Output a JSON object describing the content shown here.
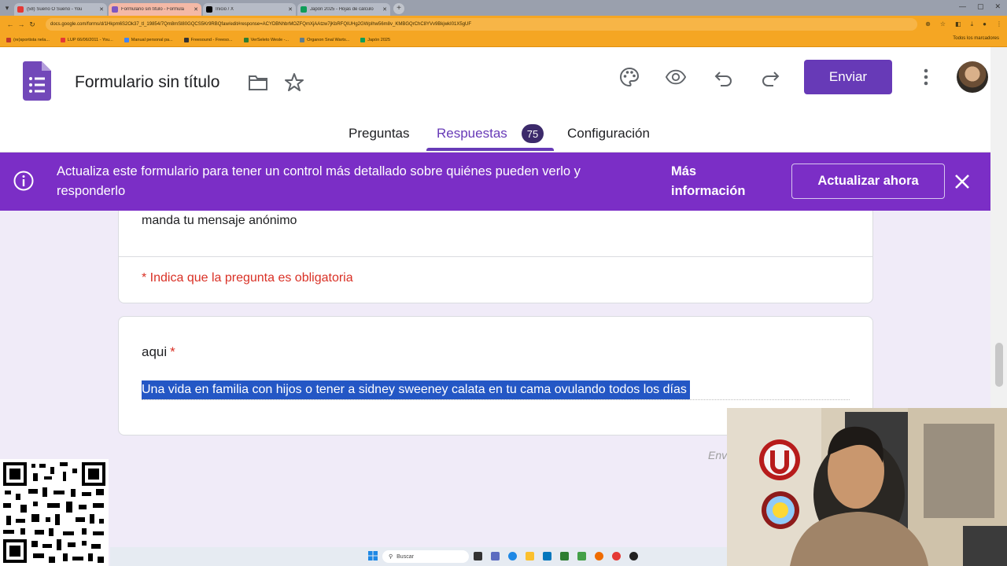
{
  "browser": {
    "tabs": [
      {
        "title": "(58) Sueño O Sueno - You",
        "fav_color": "#e53935",
        "active": false
      },
      {
        "title": "Formulario sin título - Formula",
        "fav_color": "#7e57c2",
        "active": true
      },
      {
        "title": "Inicio / X",
        "fav_color": "#000000",
        "active": false
      },
      {
        "title": "Japón 2025 - Hojas de cálculo",
        "fav_color": "#0f9d58",
        "active": false
      }
    ],
    "url": "docs.google.com/forms/d/1Hkpm6S2Ok37_tl_19854/7Qm8mSl80GQCS5Kr9RBQfaw/edit#response=ACYDBNhbrMOZFQmXjAAtzw7jKbRFQIUHg2GWpIhw56m8v_KMBGQrChC8YVv9BkjwkI01X5gUF",
    "bookmarks": [
      "(re)sportista nela...",
      "LUP 66/06/2011 - You...",
      "Manual personal pa...",
      "Freesound - Freeso...",
      "VerSeleto Wesle -...",
      "Organon Snal Warts...",
      "Japón 2025"
    ],
    "bookmarks_all": "Todos los marcadores"
  },
  "header": {
    "form_title": "Formulario sin título",
    "send_label": "Enviar",
    "tabs": [
      {
        "label": "Preguntas",
        "active": false
      },
      {
        "label": "Respuestas",
        "active": true
      },
      {
        "label": "Configuración",
        "active": false
      }
    ],
    "responses_count": "75"
  },
  "banner": {
    "message": "Actualiza este formulario para tener un control más detallado sobre quiénes pueden verlo y responderlo",
    "more_info": "Más información",
    "update_button": "Actualizar ahora"
  },
  "form": {
    "description": "manda tu mensaje anónimo",
    "required_note": "* Indica que la pregunta es obligatoria",
    "question": {
      "title": "aqui",
      "required_marker": "*",
      "answer": "Una vida en familia con hijos o tener a sidney sweeney calata en tu cama ovulando todos los días"
    },
    "send_link": "Env"
  },
  "taskbar": {
    "search_placeholder": "Buscar"
  },
  "colors": {
    "accent": "#673ab7",
    "banner": "#7b2ec6",
    "required": "#d93025",
    "selection": "#2457c5"
  }
}
